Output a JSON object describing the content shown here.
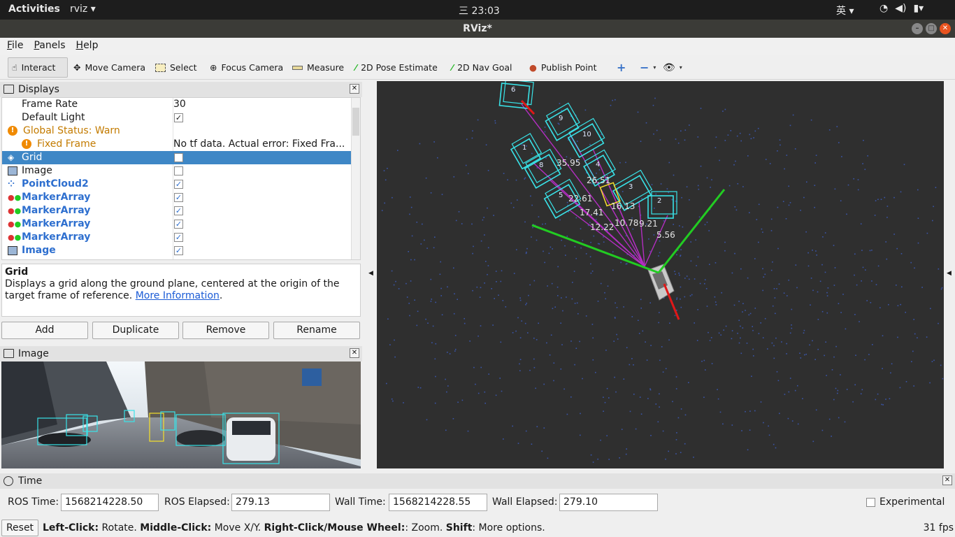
{
  "topbar": {
    "activities": "Activities",
    "app": "rviz ▾",
    "clock": "三 23:03",
    "ime": "英 ▾"
  },
  "window": {
    "title": "RViz*"
  },
  "menu": [
    "File",
    "Panels",
    "Help"
  ],
  "toolbar": {
    "interact": "Interact",
    "move_camera": "Move Camera",
    "select": "Select",
    "focus_camera": "Focus Camera",
    "measure": "Measure",
    "pose_estimate": "2D Pose Estimate",
    "nav_goal": "2D Nav Goal",
    "publish_point": "Publish Point"
  },
  "displays": {
    "title": "Displays",
    "rows": [
      {
        "name": "Frame Rate",
        "value": "30"
      },
      {
        "name": "Default Light",
        "checked": "✓"
      },
      {
        "name": "Global Status: Warn"
      },
      {
        "name": "Fixed Frame",
        "value": "No tf data.  Actual error: Fixed Fra..."
      },
      {
        "name": "Grid",
        "checked": ""
      },
      {
        "name": "Image",
        "checked": ""
      },
      {
        "name": "PointCloud2",
        "checked": "✓"
      },
      {
        "name": "MarkerArray",
        "checked": "✓"
      },
      {
        "name": "MarkerArray",
        "checked": "✓"
      },
      {
        "name": "MarkerArray",
        "checked": "✓"
      },
      {
        "name": "MarkerArray",
        "checked": "✓"
      },
      {
        "name": "Image",
        "checked": "✓"
      }
    ],
    "desc_title": "Grid",
    "desc_text": "Displays a grid along the ground plane, centered at the origin of the target frame of reference.",
    "desc_link": "More Information",
    "desc_end": ".",
    "buttons": [
      "Add",
      "Duplicate",
      "Remove",
      "Rename"
    ]
  },
  "image_panel": {
    "title": "Image"
  },
  "viewport": {
    "distances": [
      "35.95",
      "26.51",
      "22.61",
      "17.41",
      "16.13",
      "12.22",
      "10.78",
      "9.21",
      "5.56"
    ],
    "box_ids": [
      "6",
      "9",
      "10",
      "1",
      "8",
      "5",
      "4",
      "3",
      "2"
    ],
    "colors": {
      "box": "#39e3e8",
      "line": "#b32ec1",
      "axis_green": "#22cc22",
      "axis_red": "#e01818",
      "bg": "#2f2f2f"
    }
  },
  "time": {
    "title": "Time",
    "ros_time_label": "ROS Time:",
    "ros_time": "1568214228.50",
    "ros_elapsed_label": "ROS Elapsed:",
    "ros_elapsed": "279.13",
    "wall_time_label": "Wall Time:",
    "wall_time": "1568214228.55",
    "wall_elapsed_label": "Wall Elapsed:",
    "wall_elapsed": "279.10",
    "experimental": "Experimental"
  },
  "status": {
    "reset": "Reset",
    "b1": "Left-Click:",
    "t1": " Rotate. ",
    "b2": "Middle-Click:",
    "t2": " Move X/Y. ",
    "b3": "Right-Click/Mouse Wheel:",
    "t3": ": Zoom. ",
    "b4": "Shift",
    "t4": ": More options.",
    "fps": "31 fps"
  }
}
